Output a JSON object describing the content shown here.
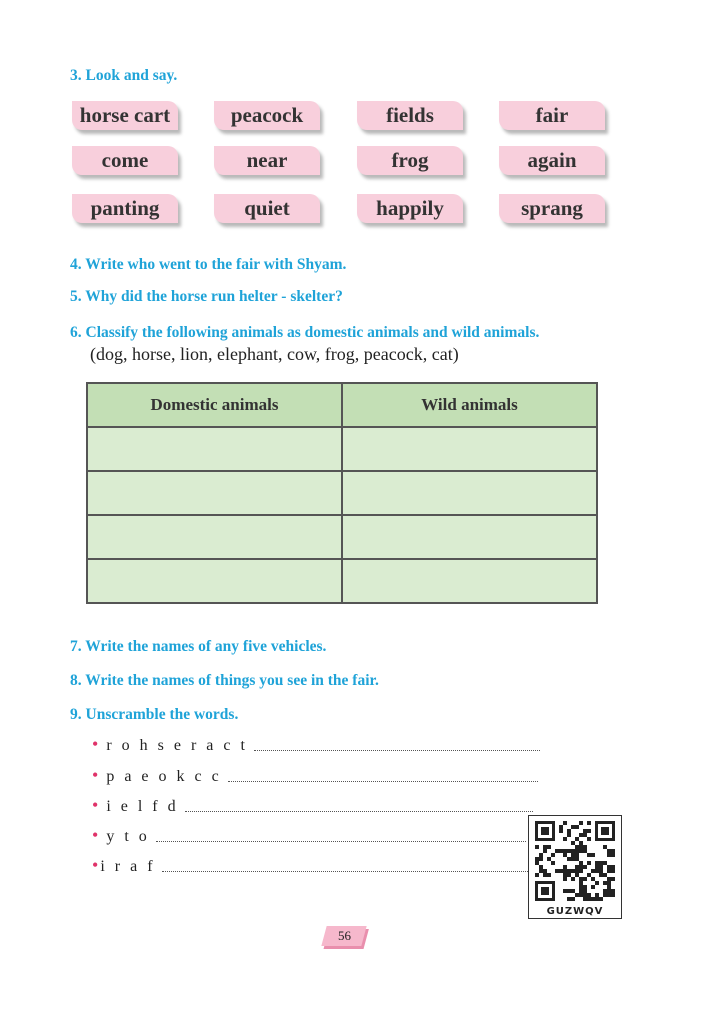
{
  "q3": {
    "title": "3. Look and say."
  },
  "word_cards": [
    "horse cart",
    "peacock",
    "fields",
    "fair",
    "come",
    "near",
    "frog",
    "again",
    "panting",
    "quiet",
    "happily",
    "sprang"
  ],
  "q4": {
    "title": "4. Write who went to the fair with Shyam."
  },
  "q5": {
    "title": "5. Why did the horse run helter - skelter?"
  },
  "q6": {
    "title": "6. Classify the following animals as domestic animals and wild animals.",
    "hint": "(dog, horse, lion, elephant, cow, frog, peacock, cat)",
    "table": {
      "headers": [
        "Domestic animals",
        "Wild animals"
      ],
      "empty_rows": 4
    }
  },
  "q7": {
    "title": "7. Write the names of any five vehicles."
  },
  "q8": {
    "title": "8. Write the names of things you see in the fair."
  },
  "q9": {
    "title": "9. Unscramble the words.",
    "words": [
      "r o h s e r a c t",
      "p a e o k c c",
      "i e l f d",
      "y t o",
      "i r a f"
    ]
  },
  "qr": {
    "label": "GUZWQV"
  },
  "page_number": "56",
  "colors": {
    "question_blue": "#1fa3d8",
    "card_pink": "#f8cfdc",
    "table_header_green": "#c3dfb5",
    "table_cell_green": "#daecd1",
    "bullet_pink": "#e0336a"
  }
}
